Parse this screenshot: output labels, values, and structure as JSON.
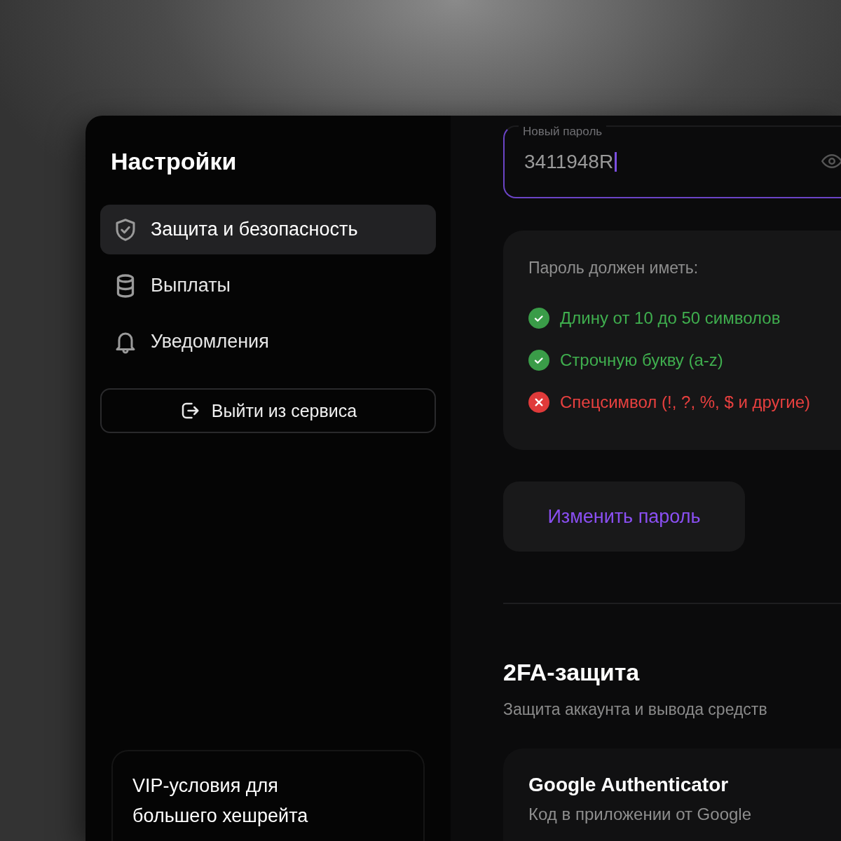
{
  "sidebar": {
    "title": "Настройки",
    "items": [
      {
        "label": "Защита и безопасность",
        "selected": true
      },
      {
        "label": "Выплаты",
        "selected": false
      },
      {
        "label": "Уведомления",
        "selected": false
      }
    ],
    "logout": "Выйти из сервиса",
    "promo": "VIP-условия для большего хешрейта"
  },
  "password_field": {
    "label": "Новый пароль",
    "value": "3411948R"
  },
  "requirements": {
    "title": "Пароль должен иметь:",
    "items": [
      {
        "text": "Длину от 10 до 50 символов",
        "met": true
      },
      {
        "text": "Строчную букву (a-z)",
        "met": true
      },
      {
        "text": "Спецсимвол (!, ?, %, $ и другие)",
        "met": false
      }
    ]
  },
  "change_button": "Изменить пароль",
  "twofa": {
    "title": "2FA-защита",
    "subtitle": "Защита аккаунта и вывода средств",
    "methods": [
      {
        "title": "Google Authenticator",
        "subtitle": "Код в приложении от Google"
      }
    ]
  }
}
